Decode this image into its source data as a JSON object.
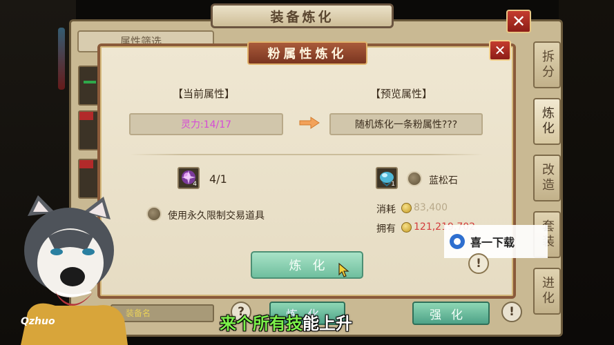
{
  "outer_window": {
    "title": "装备炼化",
    "close_label": "✕",
    "filter_label": "属性筛选",
    "side_tabs": [
      "拆分",
      "炼化",
      "改造",
      "套装",
      "进化"
    ],
    "bottom_input_text": "装备名",
    "help_label": "?",
    "refine_label": "炼化",
    "strengthen_label": "强化",
    "info_label": "!"
  },
  "dialog": {
    "title": "粉属性炼化",
    "close_label": "✕",
    "current_header": "【当前属性】",
    "preview_header": "【预览属性】",
    "current_value": "灵力:14/17",
    "preview_value": "随机炼化一条粉属性???",
    "material_count": "4/1",
    "material_icon_count": "4",
    "use_permanent_label": "使用永久限制交易道具",
    "turquoise_label": "蓝松石",
    "turquoise_icon_count": "1",
    "cost_label": "消耗",
    "cost_value": "83,400",
    "owned_label": "拥有",
    "owned_value": "121,219,702",
    "refine_button": "炼化",
    "warn_label": "!"
  },
  "watermark": {
    "text": "喜一下载"
  },
  "overlay": {
    "avatar_caption": "Qzhuo",
    "subtitle_green": "来个所有技",
    "subtitle_white": "能上升"
  },
  "colors": {
    "current_value": "#d64bd6",
    "cost_value": "#b8a98a",
    "owned_value": "#d23b3b",
    "subtitle_green": "#7cf04a",
    "dialog_title_bg": "#8e4429"
  }
}
